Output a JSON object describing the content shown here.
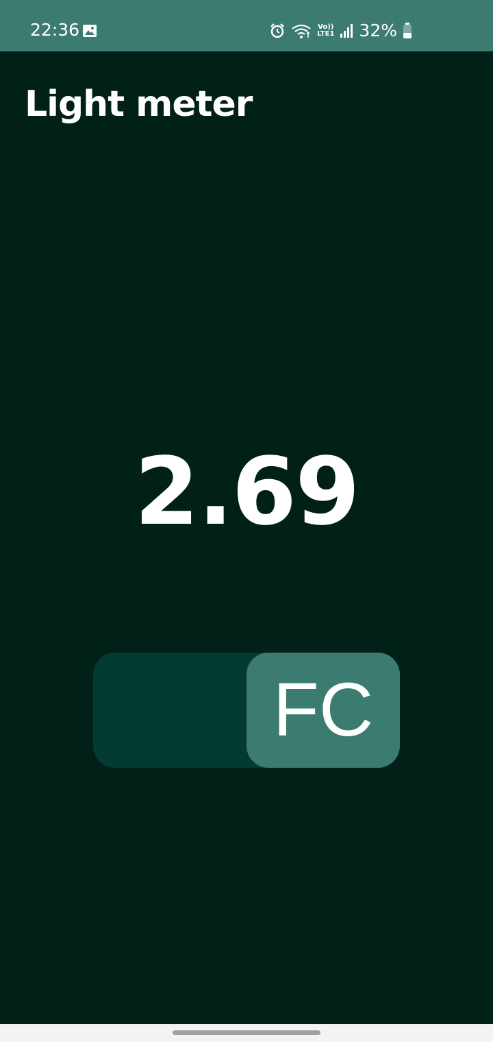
{
  "status_bar": {
    "time": "22:36",
    "network_top": "Vo))",
    "network_bottom": "LTE1",
    "battery_percent": "32%",
    "icons": [
      "gallery-icon",
      "alarm-icon",
      "wifi-icon",
      "lte-icon",
      "signal-icon",
      "battery-icon"
    ]
  },
  "header": {
    "title": "Light meter"
  },
  "meter": {
    "reading": "2.69"
  },
  "unit_toggle": {
    "selected_label": "FC",
    "selected_side": "right"
  },
  "colors": {
    "background": "#012018",
    "accent": "#3c7b6f",
    "toggle_track": "#023b31",
    "text": "#ffffff"
  }
}
